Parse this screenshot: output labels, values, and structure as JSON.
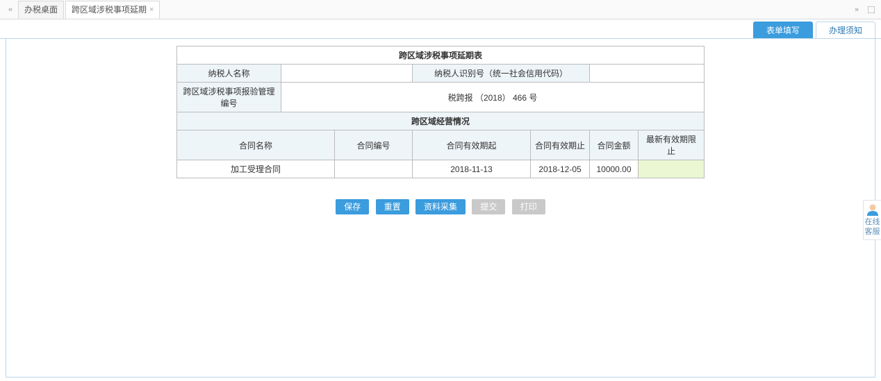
{
  "tabs": {
    "tab1": "办税桌面",
    "tab2": "跨区域涉税事项延期"
  },
  "sub_tabs": {
    "form_fill": "表单填写",
    "notice": "办理须知"
  },
  "form": {
    "title": "跨区域涉税事项延期表",
    "labels": {
      "taxpayer_name": "纳税人名称",
      "taxpayer_id": "纳税人识别号（统一社会信用代码）",
      "mgmt_no": "跨区域涉税事项报验管理编号",
      "section": "跨区域经营情况"
    },
    "values": {
      "taxpayer_name": "",
      "taxpayer_id": "",
      "mgmt_no": "税跨报 （2018） 466 号"
    },
    "grid_headers": {
      "contract_name": "合同名称",
      "contract_no": "合同编号",
      "valid_from": "合同有效期起",
      "valid_to": "合同有效期止",
      "amount": "合同金额",
      "new_valid_to": "最新有效期限止"
    },
    "grid_row": {
      "contract_name": "加工受理合同",
      "contract_no": "",
      "valid_from": "2018-11-13",
      "valid_to": "2018-12-05",
      "amount": "10000.00",
      "new_valid_to": ""
    }
  },
  "buttons": {
    "save": "保存",
    "reset": "重置",
    "collect": "资料采集",
    "submit": "提交",
    "print": "打印"
  },
  "float": {
    "label": "在线客服"
  }
}
